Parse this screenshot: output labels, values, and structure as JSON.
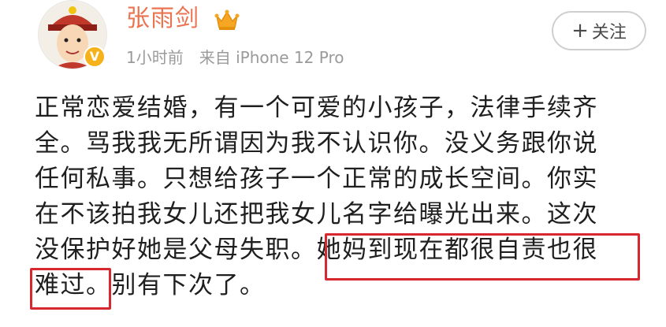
{
  "user": {
    "name": "张雨剑",
    "verified_badge": "V",
    "crown_icon": "crown-icon",
    "avatar_icon": "cartoon-avatar"
  },
  "meta": {
    "time": "1小时前",
    "source": "来自 iPhone 12 Pro"
  },
  "follow_button": {
    "plus": "+",
    "label": "关注"
  },
  "post": {
    "lines": [
      "正常恋爱结婚，有一个可爱的小孩子，法律手续齐",
      "全。骂我我无所谓因为我不认识你。没义务跟你说",
      "任何私事。只想给孩子一个正常的成长空间。你实",
      "在不该拍我女儿还把我女儿名字给曝光出来。这次",
      "没保护好她是父母失职。她妈到现在都很自责也很",
      "难过。别有下次了。"
    ]
  },
  "colors": {
    "username": "#eb7350",
    "meta": "#9a9a9a",
    "highlight": "#d7282f",
    "badge": "#f6b21a"
  }
}
